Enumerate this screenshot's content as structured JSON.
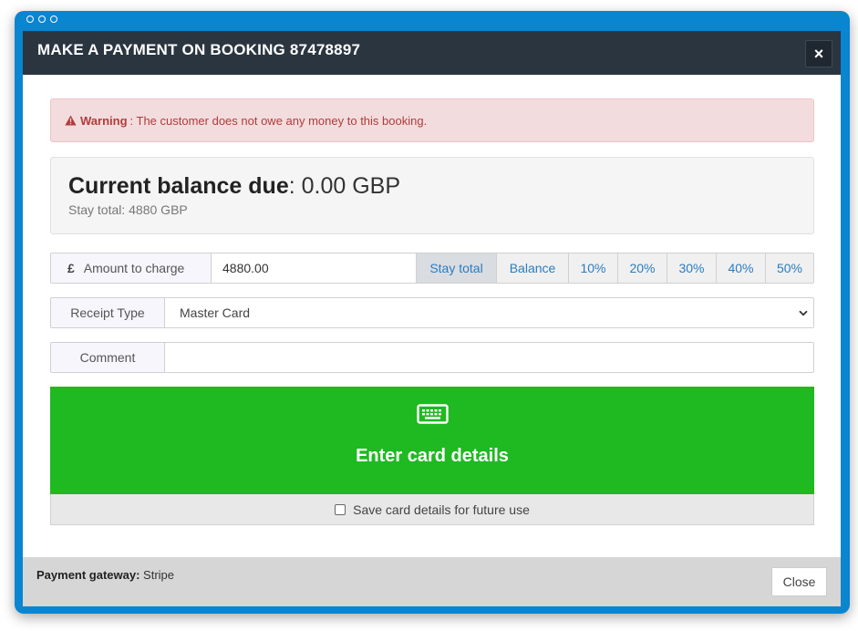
{
  "window": {
    "title": "MAKE A PAYMENT ON BOOKING 87478897",
    "close_symbol": "×"
  },
  "alert": {
    "label": "Warning",
    "message": ": The customer does not owe any money to this booking.",
    "icon": "warning-triangle-icon"
  },
  "balance": {
    "label": "Current balance due",
    "value": ": 0.00 GBP",
    "stay_total": "Stay total: 4880 GBP"
  },
  "amount": {
    "currency_symbol": "£",
    "label": "Amount to charge",
    "value": "4880.00",
    "quick_buttons": [
      {
        "label": "Stay total",
        "active": true
      },
      {
        "label": "Balance"
      },
      {
        "label": "10%"
      },
      {
        "label": "20%"
      },
      {
        "label": "30%"
      },
      {
        "label": "40%"
      },
      {
        "label": "50%"
      }
    ]
  },
  "receipt": {
    "label": "Receipt Type",
    "selected": "Master Card"
  },
  "comment": {
    "label": "Comment",
    "value": ""
  },
  "card": {
    "button_label": "Enter card details",
    "icon": "keyboard-icon",
    "save_label": "Save card details for future use",
    "save_checked": false
  },
  "footer": {
    "gateway_label": "Payment gateway:",
    "gateway_value": " Stripe",
    "close_label": "Close"
  },
  "colors": {
    "window_frame": "#0a85d0",
    "header_bg": "#2a3540",
    "alert_bg": "#f3dcdd",
    "alert_text": "#b23b3b",
    "card_button": "#1fb922",
    "link_blue": "#2b7cc0"
  }
}
